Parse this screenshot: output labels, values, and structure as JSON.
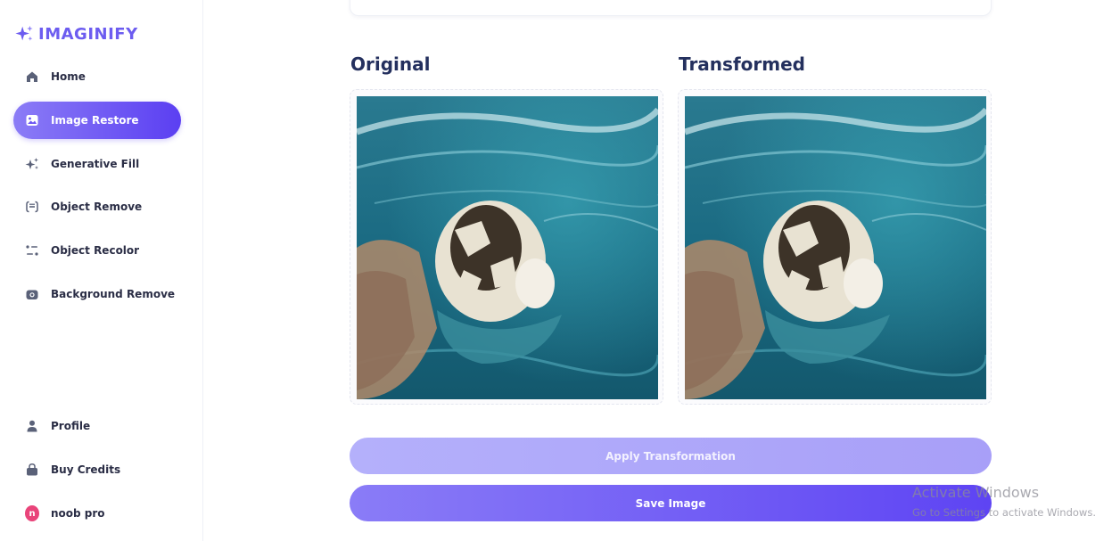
{
  "app": {
    "name": "IMAGINIFY",
    "brand_color": "#6c5cf0"
  },
  "sidebar": {
    "items": [
      {
        "label": "Home",
        "icon": "home-icon",
        "active": false
      },
      {
        "label": "Image Restore",
        "icon": "image-icon",
        "active": true
      },
      {
        "label": "Generative Fill",
        "icon": "stars-icon",
        "active": false
      },
      {
        "label": "Object Remove",
        "icon": "scan-icon",
        "active": false
      },
      {
        "label": "Object Recolor",
        "icon": "filter-icon",
        "active": false
      },
      {
        "label": "Background Remove",
        "icon": "camera-icon",
        "active": false
      }
    ],
    "bottom_items": [
      {
        "label": "Profile",
        "icon": "user-icon"
      },
      {
        "label": "Buy Credits",
        "icon": "bag-icon"
      }
    ],
    "user": {
      "name": "noob pro",
      "initial": "n",
      "avatar_color": "#e9447a"
    }
  },
  "main": {
    "original_heading": "Original",
    "transformed_heading": "Transformed",
    "apply_button": "Apply Transformation",
    "save_button": "Save Image",
    "accent_gradient": [
      "#8a7cf7",
      "#5e44f3"
    ]
  },
  "watermark": {
    "title": "Activate Windows",
    "subtitle": "Go to Settings to activate Windows."
  }
}
